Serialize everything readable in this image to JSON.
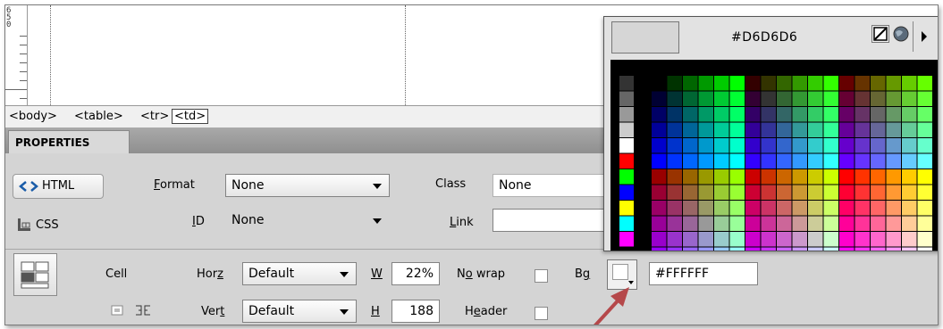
{
  "ruler": {
    "digits": [
      "6",
      "5",
      "0"
    ]
  },
  "tag_selector": {
    "tags": [
      "<body>",
      "<table>",
      "<tr>",
      "<td>"
    ]
  },
  "properties": {
    "tab_label": "PROPERTIES",
    "html_button": "HTML",
    "css_button": "CSS",
    "format_label": "Format",
    "format_value": "None",
    "id_label": "ID",
    "id_value": "None",
    "class_label": "Class",
    "class_value": "None",
    "link_label": "Link",
    "link_value": "",
    "cell_label": "Cell",
    "horz_label": "Horz",
    "horz_value": "Default",
    "vert_label": "Vert",
    "vert_value": "Default",
    "w_label": "W",
    "w_value": "22%",
    "h_label": "H",
    "h_value": "188",
    "nowrap_label": "No wrap",
    "header_label": "Header",
    "bg_label": "Bg",
    "bg_value": "#FFFFFF"
  },
  "color_picker": {
    "hex": "#D6D6D6",
    "preview_color": "#D6D6D6"
  },
  "colors": {
    "arrow": "#b5484a",
    "html_icon": "#1a5ca8"
  }
}
